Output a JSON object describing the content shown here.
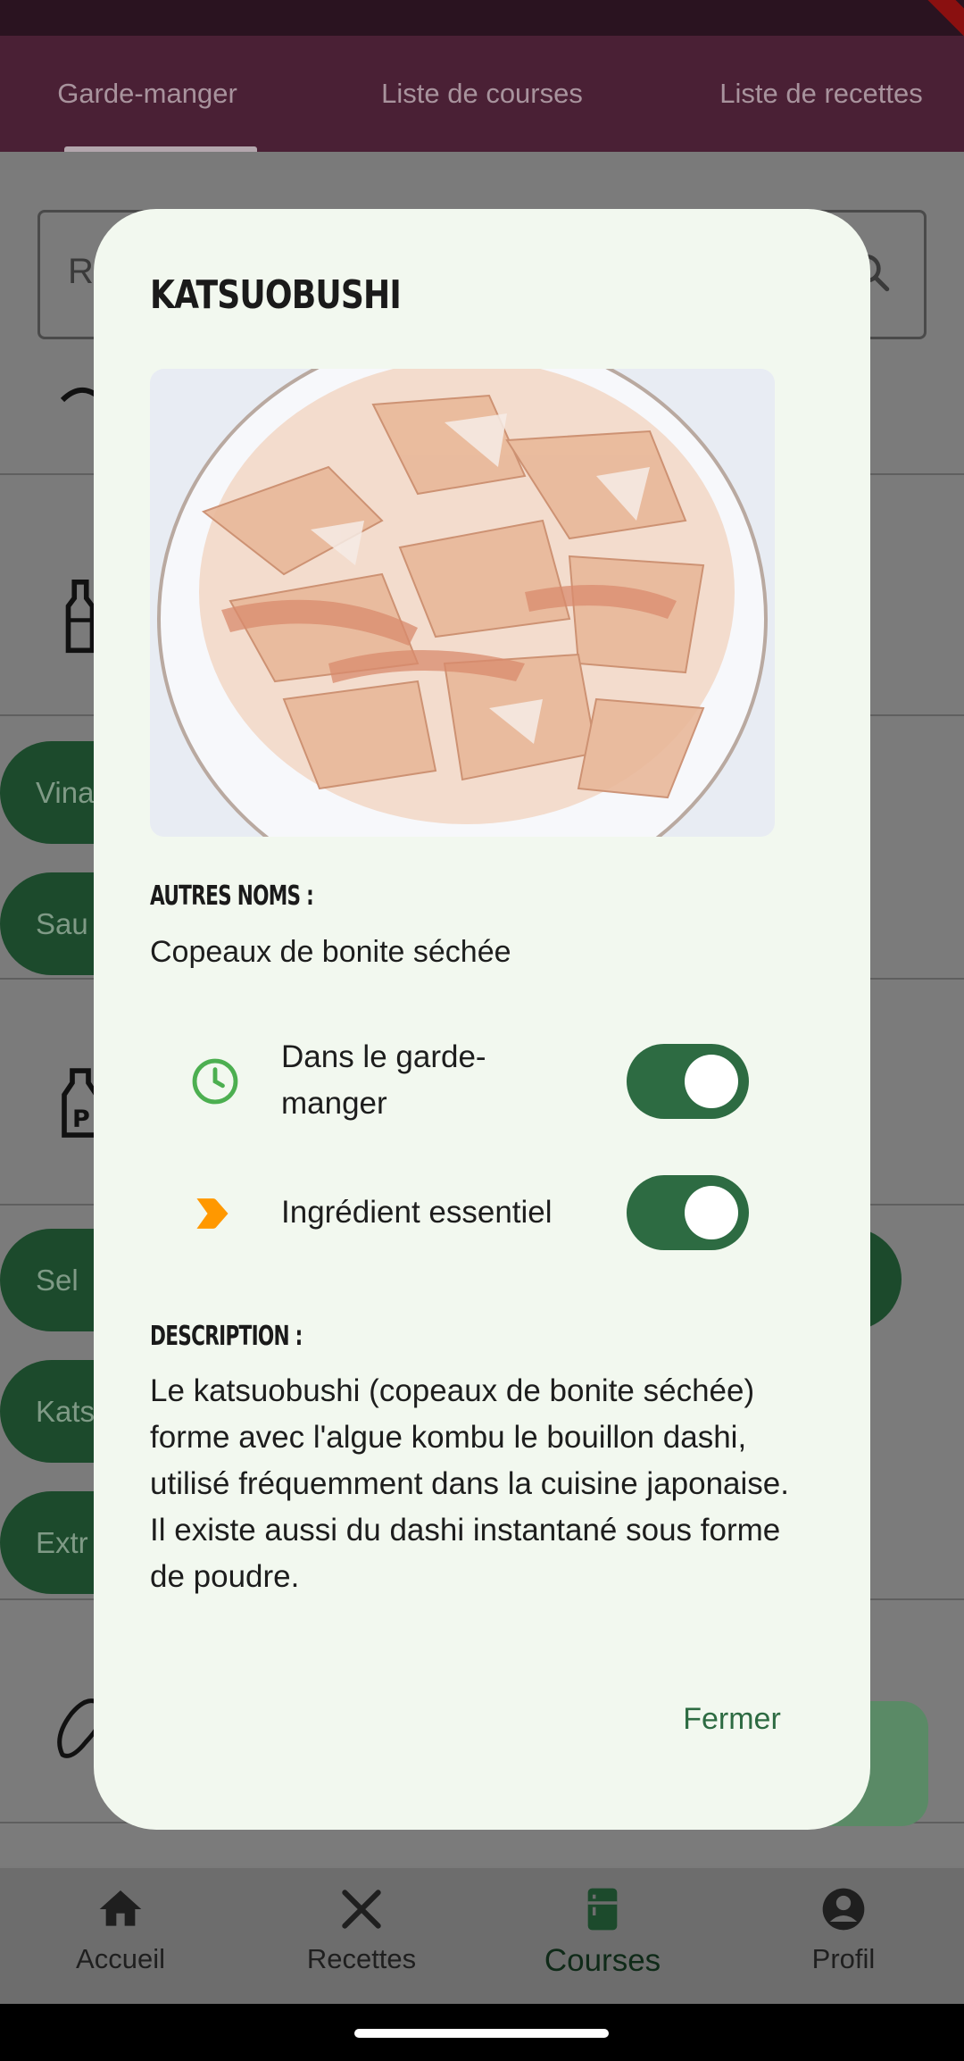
{
  "tabs": {
    "pantry": "Garde-manger",
    "shopping_list": "Liste de courses",
    "recipe_list": "Liste de recettes"
  },
  "search": {
    "partial_text": "Re"
  },
  "chips": {
    "vina": "Vina",
    "sau": "Sau",
    "sel": "Sel",
    "kats": "Kats",
    "extr": "Extr"
  },
  "dialog": {
    "title": "KATSUOBUSHI",
    "photo_icon": "katsuobushi-photo",
    "other_names_label": "AUTRES NOMS :",
    "other_names": "Copeaux de bonite séchée",
    "in_pantry_label": "Dans le garde-manger",
    "in_pantry": true,
    "essential_label": "Ingrédient essentiel",
    "essential": true,
    "description_label": "DESCRIPTION :",
    "description": "Le katsuobushi (copeaux de bonite séchée) forme avec l'algue kombu le bouillon dashi, utilisé fréquemment dans la cuisine japonaise. Il existe aussi du dashi instantané sous forme de poudre.",
    "close_label": "Fermer"
  },
  "bottom_nav": {
    "home": "Accueil",
    "recipes": "Recettes",
    "shopping": "Courses",
    "profile": "Profil"
  },
  "colors": {
    "app_bar": "#4a2035",
    "accent_green": "#2d6b42",
    "dialog_bg": "#f2f8ef",
    "clock_icon": "#4caf50",
    "essential_icon": "#ff9800"
  }
}
